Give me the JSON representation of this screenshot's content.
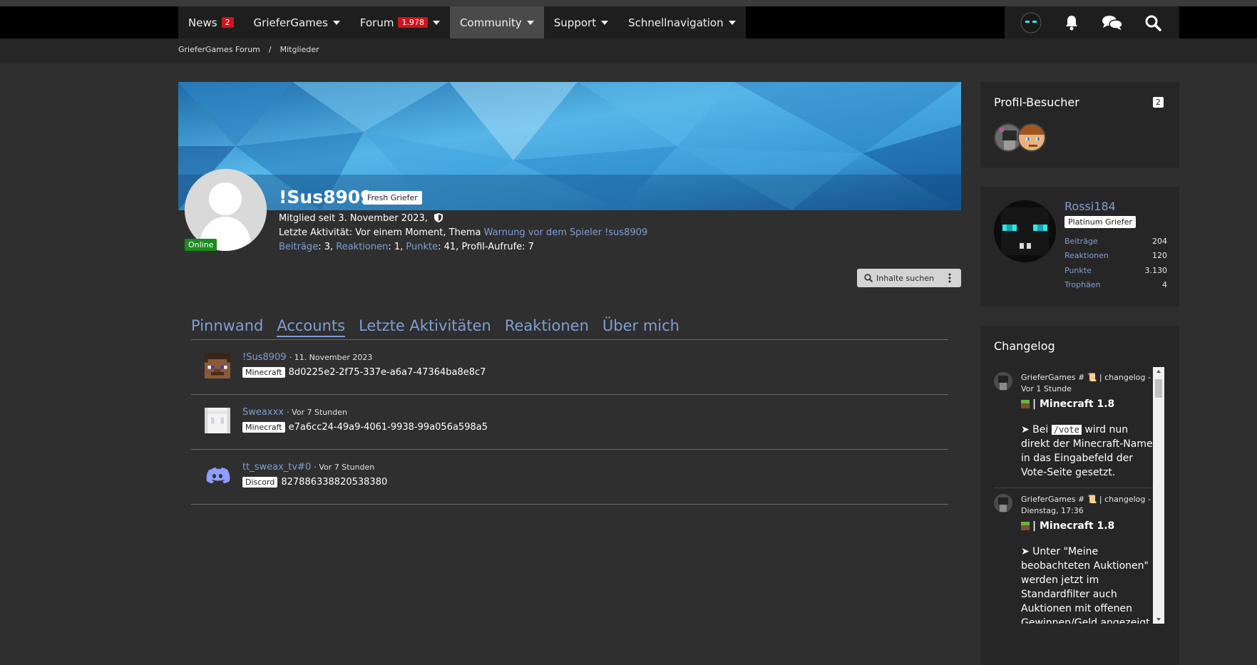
{
  "nav": {
    "items": [
      {
        "label": "News",
        "badge": "2"
      },
      {
        "label": "GrieferGames"
      },
      {
        "label": "Forum",
        "badge": "1.978"
      },
      {
        "label": "Community"
      },
      {
        "label": "Support"
      },
      {
        "label": "Schnellnavigation"
      }
    ],
    "active": "Community"
  },
  "breadcrumb": [
    "GrieferGames Forum",
    "/",
    "Mitglieder"
  ],
  "profile": {
    "username": "!Sus8909",
    "user_title": "Fresh Griefer",
    "status": "Online",
    "member_since": "Mitglied seit 3. November 2023,",
    "last_activity_prefix": "Letzte Aktivität: Vor einem Moment, Thema",
    "last_activity_link": "Warnung vor dem Spieler !sus8909",
    "stats": {
      "posts_label": "Beiträge",
      "posts_value": ": 3,",
      "reactions_label": "Reaktionen",
      "reactions_value": ": 1,",
      "points_label": "Punkte",
      "points_value": ": 41, Profil-Aufrufe: 7"
    },
    "search_button": "Inhalte suchen"
  },
  "tabs": [
    "Pinnwand",
    "Accounts",
    "Letzte Aktivitäten",
    "Reaktionen",
    "Über mich"
  ],
  "active_tab": "Accounts",
  "accounts": [
    {
      "name": "!Sus8909",
      "time": "· 11. November 2023",
      "type": "Minecraft",
      "id": "8d0225e2-2f75-337e-a6a7-47364ba8e8c7",
      "avatar": "steve-avatar"
    },
    {
      "name": "Sweaxxx",
      "time": "· Vor 7 Stunden",
      "type": "Minecraft",
      "id": "e7a6cc24-49a9-4061-9938-99a056a598a5",
      "avatar": "white-skin-avatar"
    },
    {
      "name": "tt_sweax_tv#0",
      "time": "· Vor 7 Stunden",
      "type": "Discord",
      "id": "827886338820538380",
      "avatar": "discord-icon"
    }
  ],
  "sidebar": {
    "visitors": {
      "title": "Profil-Besucher",
      "count": "2"
    },
    "featured": {
      "name": "Rossi184",
      "title": "Platinum Griefer",
      "stats": [
        {
          "label": "Beiträge",
          "value": "204"
        },
        {
          "label": "Reaktionen",
          "value": "120"
        },
        {
          "label": "Punkte",
          "value": "3.130"
        },
        {
          "label": "Trophäen",
          "value": "4"
        }
      ]
    },
    "changelog": {
      "title": "Changelog",
      "entries": [
        {
          "head": "GrieferGames # 📜 | changelog - Vor 1 Stunde",
          "sub": "| Minecraft 1.8",
          "body_pre": "➤ Bei",
          "code": "/vote",
          "body_post": "wird nun direkt der Minecraft-Name in das Eingabefeld der Vote-Seite gesetzt."
        },
        {
          "head": "GrieferGames # 📜 | changelog - Dienstag, 17:36",
          "sub": "| Minecraft 1.8",
          "body": "➤ Unter \"Meine beobachteten Auktionen\" werden jetzt im Standardfilter auch Auktionen mit offenen Gewinnen/Geld angezeigt."
        }
      ]
    }
  },
  "colors": {
    "accent": "#7f9ed4",
    "badge": "#d0121b",
    "online": "#1c8a1c"
  }
}
